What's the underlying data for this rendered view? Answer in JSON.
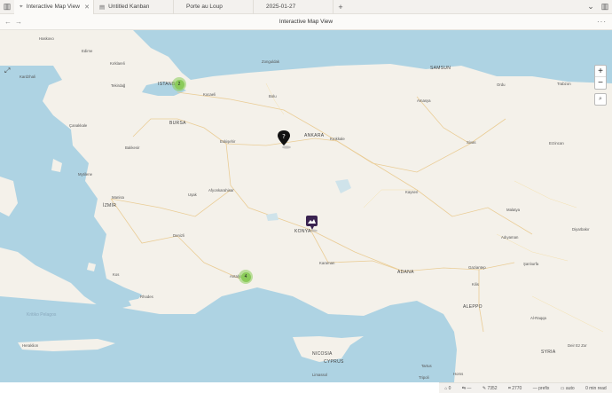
{
  "tabs": [
    {
      "label": "Interactive Map View",
      "icon": "map-pin-icon",
      "active": true
    },
    {
      "label": "Untitled Kanban",
      "icon": "kanban-icon",
      "active": false
    },
    {
      "label": "Porte au Loup",
      "icon": "",
      "active": false
    },
    {
      "label": "2025-01-27",
      "icon": "",
      "active": false
    }
  ],
  "view": {
    "title": "Interactive Map View"
  },
  "map": {
    "cities": [
      {
        "name": "Haskovo"
      },
      {
        "name": "Edirne"
      },
      {
        "name": "Kırklareli"
      },
      {
        "name": "Kardzhali"
      },
      {
        "name": "Tekirdağ"
      },
      {
        "name": "ISTANBUL"
      },
      {
        "name": "Kocaeli"
      },
      {
        "name": "Zonguldak"
      },
      {
        "name": "Bolu"
      },
      {
        "name": "SAMSUN"
      },
      {
        "name": "Ordu"
      },
      {
        "name": "Trabzon"
      },
      {
        "name": "Amasya"
      },
      {
        "name": "Çanakkale"
      },
      {
        "name": "BURSA"
      },
      {
        "name": "Eskişehir"
      },
      {
        "name": "ANKARA"
      },
      {
        "name": "Kırıkkale"
      },
      {
        "name": "Sivas"
      },
      {
        "name": "Erzincan"
      },
      {
        "name": "Balıkesir"
      },
      {
        "name": "Mytilene"
      },
      {
        "name": "Manisa"
      },
      {
        "name": "Uşak"
      },
      {
        "name": "Afyonkarahisar"
      },
      {
        "name": "İZMİR"
      },
      {
        "name": "Kayseri"
      },
      {
        "name": "Malatya"
      },
      {
        "name": "Diyarbakır"
      },
      {
        "name": "Denizli"
      },
      {
        "name": "KONYA"
      },
      {
        "name": "Adıyaman"
      },
      {
        "name": "Şanlıurfa"
      },
      {
        "name": "Karaman"
      },
      {
        "name": "ADANA"
      },
      {
        "name": "Gaziantep"
      },
      {
        "name": "Kos"
      },
      {
        "name": "Rhodes"
      },
      {
        "name": "Kilis"
      },
      {
        "name": "ALEPPO"
      },
      {
        "name": "Al-Raqqa"
      },
      {
        "name": "Deir Ez Zor"
      },
      {
        "name": "Heraklion"
      },
      {
        "name": "NICOSIA"
      },
      {
        "name": "CYPRUS"
      },
      {
        "name": "Limassol"
      },
      {
        "name": "Tartus"
      },
      {
        "name": "Homs"
      },
      {
        "name": "Tripoli"
      },
      {
        "name": "SYRIA"
      },
      {
        "name": "Antalya"
      },
      {
        "name": "Kritiko Pelagos"
      }
    ],
    "markers": [
      {
        "label": "?",
        "icon": "question-marker-icon"
      },
      {
        "label": "",
        "icon": "photo-marker-icon"
      }
    ],
    "clusters": [
      {
        "count": "2"
      },
      {
        "count": "4"
      }
    ],
    "controls": {
      "zoom_in": "+",
      "zoom_out": "−"
    }
  },
  "status": {
    "backlinks": "0",
    "outlinks": "—",
    "words": "7352",
    "characters": "2770",
    "prefix": "prefix",
    "mode": "auto",
    "read_time": "0 min read"
  }
}
